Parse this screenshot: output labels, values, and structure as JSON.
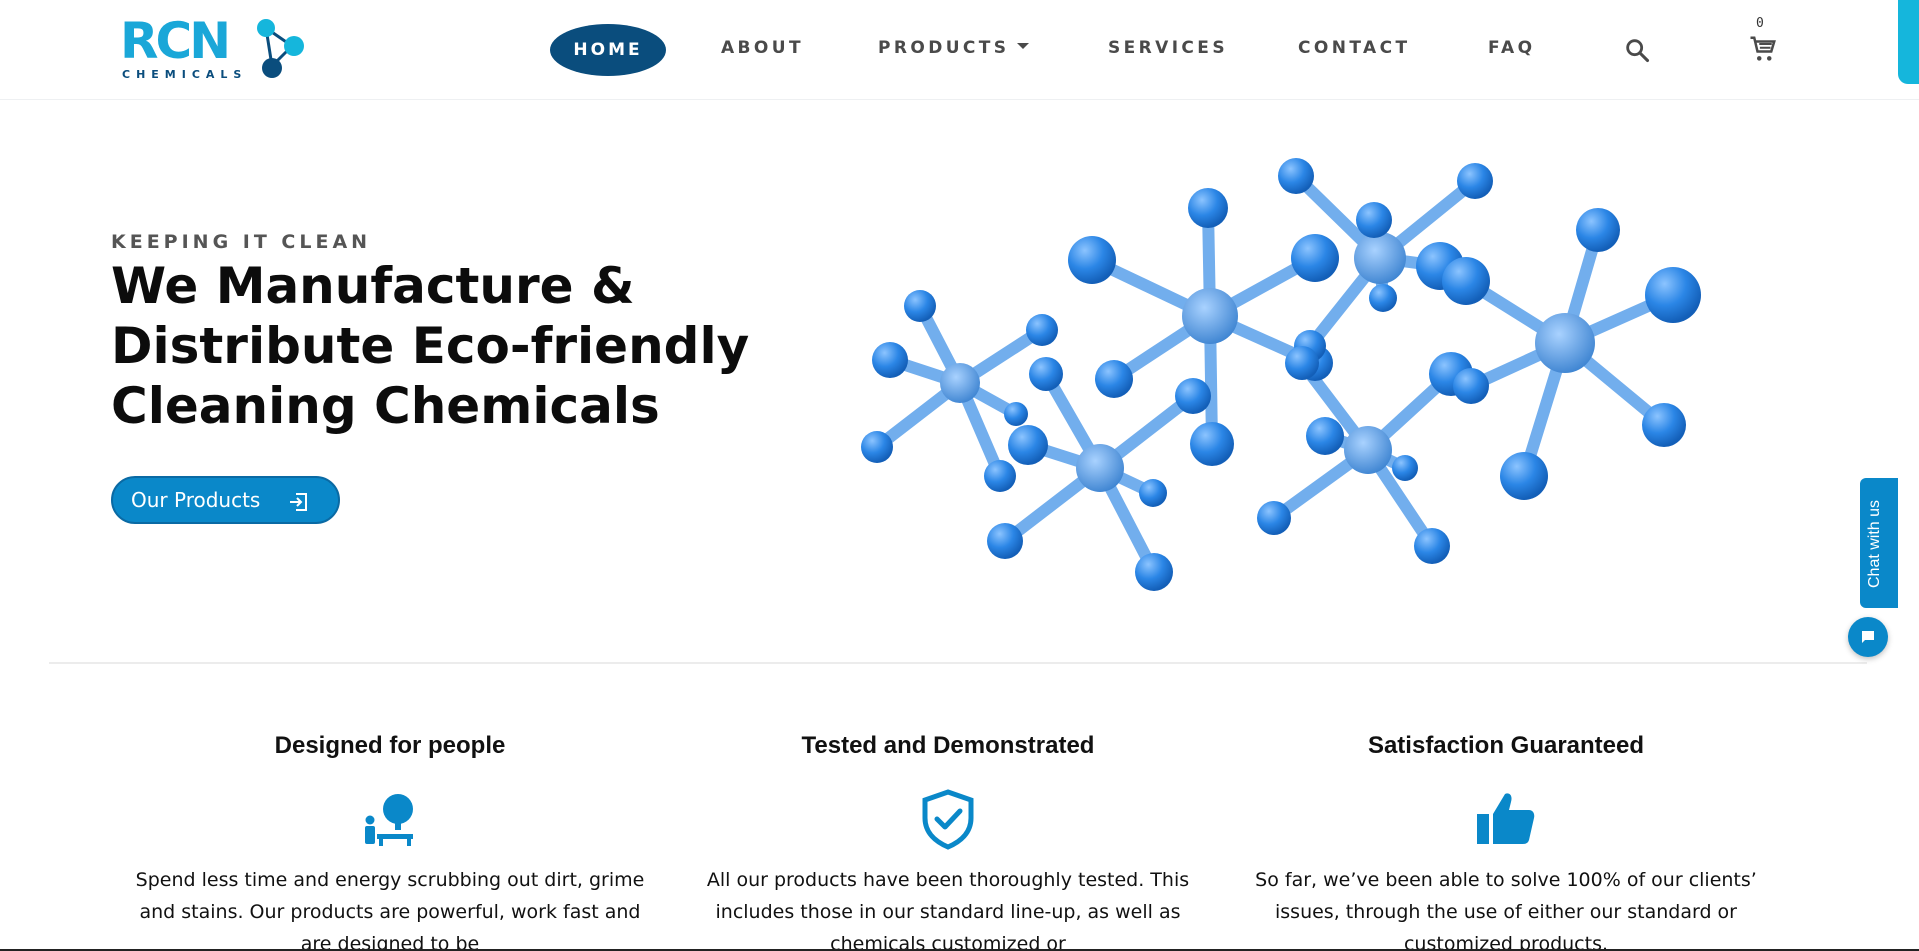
{
  "colors": {
    "primary_dark": "#0a4d7d",
    "primary": "#0a88c9",
    "accent_cyan": "#15b6dc",
    "molecule_blue": "#3a8be0"
  },
  "header": {
    "logo_text": "RCN",
    "logo_subtext": "CHEMICALS",
    "nav": {
      "home": "HOME",
      "about": "ABOUT",
      "products": "PRODUCTS",
      "services": "SERVICES",
      "contact": "CONTACT",
      "faq": "FAQ"
    },
    "cart_count": "0",
    "icons": {
      "search": "search-icon",
      "cart": "cart-icon"
    }
  },
  "hero": {
    "eyebrow": "KEEPING IT CLEAN",
    "title": "We Manufacture & Distribute Eco-friendly Cleaning Chemicals",
    "cta_label": "Our Products",
    "cta_icon": "enter-icon"
  },
  "features": [
    {
      "title": "Designed for people",
      "icon": "person-icon",
      "text": "Spend less time and energy scrubbing out dirt, grime and stains. Our products are powerful, work fast and are designed to be"
    },
    {
      "title": "Tested and Demonstrated",
      "icon": "shield-check-icon",
      "text": "All our products have been thoroughly tested. This includes those in our standard line-up, as well as chemicals customized or"
    },
    {
      "title": "Satisfaction Guaranteed",
      "icon": "thumbs-up-icon",
      "text": "So far, we’ve been able to solve 100% of our clients’ issues, through the use of either our standard or customized products."
    }
  ],
  "chat": {
    "label": "Chat with us",
    "icon": "chat-icon"
  }
}
